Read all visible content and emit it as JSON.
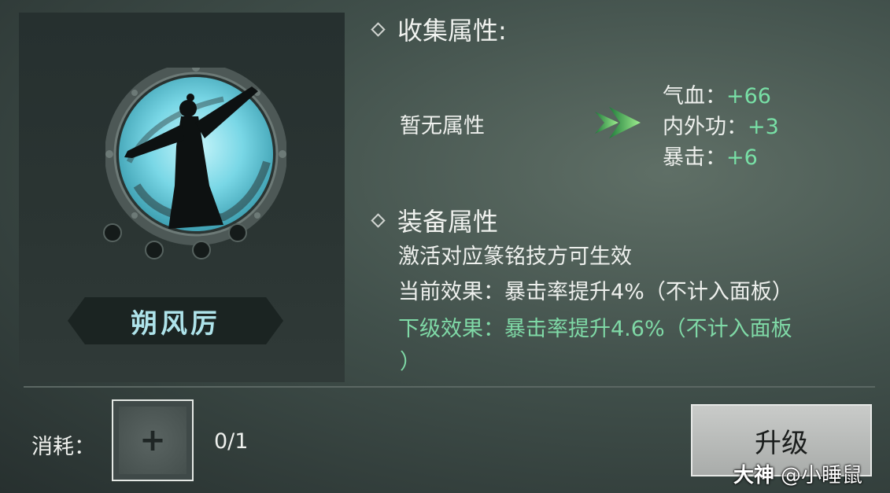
{
  "card": {
    "name": "朔风厉"
  },
  "collect": {
    "title": "收集属性:",
    "none_text": "暂无属性",
    "bonuses": [
      {
        "label": "气血：",
        "value": "+66"
      },
      {
        "label": "内外功：",
        "value": "+3"
      },
      {
        "label": "暴击：",
        "value": "+6"
      }
    ]
  },
  "equip": {
    "title": "装备属性",
    "hint": "激活对应篆铭技方可生效",
    "current": "当前效果：暴击率提升4%（不计入面板）",
    "next_line1": "下级效果：暴击率提升4.6%（不计入面板",
    "next_line2": "）"
  },
  "cost": {
    "label": "消耗：",
    "count": "0/1",
    "slot_symbol": "+"
  },
  "upgrade_label": "升级",
  "watermark": {
    "brand": "大神",
    "handle": "@小睡鼠"
  },
  "colors": {
    "bonus_green": "#78e0a6",
    "emblem_cyan": "#8fe3ef"
  }
}
